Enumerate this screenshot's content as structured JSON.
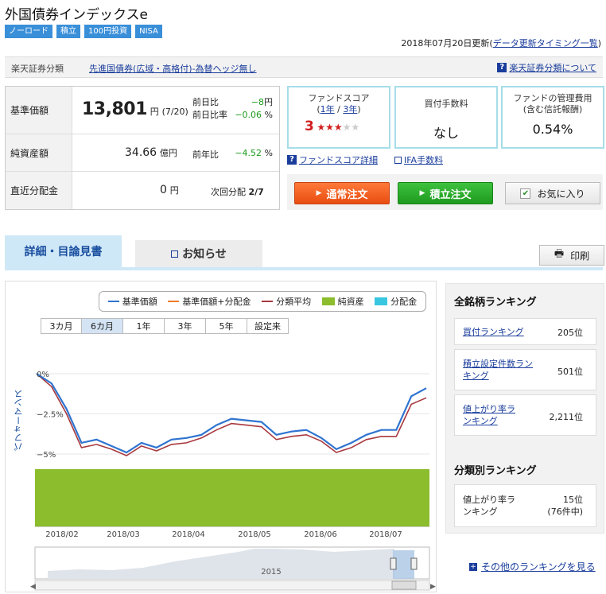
{
  "fund": {
    "title": "外国債券インデックスe",
    "tags": [
      "ノーロード",
      "積立",
      "100円投資",
      "NISA"
    ]
  },
  "update": {
    "date_text": "2018年07月20日更新(",
    "link_text": "データ更新タイミング一覧",
    "close_paren": ")"
  },
  "classification": {
    "label": "楽天証券分類",
    "value": "先進国債券(広域・高格付)-為替ヘッジ無し",
    "help_link": "楽天証券分類について"
  },
  "price": {
    "nav_label": "基準価額",
    "nav_value": "13,801",
    "nav_unit": "円",
    "nav_date": "(7/20)",
    "prev_diff_label": "前日比",
    "prev_diff_value": "−8",
    "prev_diff_unit": "円",
    "prev_ratio_label": "前日比率",
    "prev_ratio_value": "−0.06",
    "prev_ratio_unit": "%",
    "assets_label": "純資産額",
    "assets_value": "34.66",
    "assets_unit": "億円",
    "yoy_label": "前年比",
    "yoy_value": "−4.52",
    "yoy_unit": "%",
    "dist_label": "直近分配金",
    "dist_value": "0",
    "dist_unit": "円",
    "next_dist_label": "次回分配",
    "next_dist_value": "2/7"
  },
  "cards": {
    "score_title_1": "ファンドスコア",
    "score_title_2_open": "(",
    "score_title_2_link": "1年",
    "score_title_2_sep": " / ",
    "score_title_2_link2": "3年",
    "score_title_2_close": ")",
    "score_value": "3",
    "score_stars": "★★★",
    "score_stars_empty": "★★",
    "fee_title": "買付手数料",
    "fee_value": "なし",
    "mgmt_title_1": "ファンドの管理費用",
    "mgmt_title_2": "(含む信託報酬)",
    "mgmt_value": "0.54%",
    "score_detail_link": "ファンドスコア詳細",
    "ifa_link": "IFA手数料"
  },
  "buttons": {
    "normal_order": "通常注文",
    "tsumitate_order": "積立注文",
    "favorite": "お気に入り",
    "print": "印刷"
  },
  "tabs": {
    "detail": "詳細・目論見書",
    "notice": "お知らせ"
  },
  "chart": {
    "legend": [
      {
        "name": "基準価額",
        "color": "#2f74d0"
      },
      {
        "name": "基準価額+分配金",
        "color": "#ee7d2a"
      },
      {
        "name": "分類平均",
        "color": "#a8393f"
      },
      {
        "name": "純資産",
        "color": "#8bbd2c"
      },
      {
        "name": "分配金",
        "color": "#39c6e0"
      }
    ],
    "ranges": [
      "3カ月",
      "6カ月",
      "1年",
      "3年",
      "5年",
      "設定来"
    ],
    "selected_range": "6カ月",
    "y_axis_label": "パフォーマンス",
    "y_ticks": [
      "0%",
      "−2.5%",
      "−5%"
    ],
    "x_ticks": [
      "2018/02",
      "2018/03",
      "2018/04",
      "2018/05",
      "2018/06",
      "2018/07"
    ],
    "navigator_label": "2015"
  },
  "chart_data": {
    "type": "line",
    "x": [
      "2018/01/22",
      "2018/01/29",
      "2018/02/05",
      "2018/02/12",
      "2018/02/19",
      "2018/02/26",
      "2018/03/05",
      "2018/03/12",
      "2018/03/19",
      "2018/03/26",
      "2018/04/02",
      "2018/04/09",
      "2018/04/16",
      "2018/04/23",
      "2018/04/30",
      "2018/05/07",
      "2018/05/14",
      "2018/05/21",
      "2018/05/28",
      "2018/06/04",
      "2018/06/11",
      "2018/06/18",
      "2018/06/25",
      "2018/07/02",
      "2018/07/09",
      "2018/07/16",
      "2018/07/20"
    ],
    "series": [
      {
        "name": "基準価額",
        "color": "#2f74d0",
        "values": [
          0.0,
          -0.6,
          -2.2,
          -4.3,
          -4.1,
          -4.5,
          -4.9,
          -4.3,
          -4.6,
          -4.1,
          -4.0,
          -3.8,
          -3.2,
          -2.8,
          -2.9,
          -3.0,
          -3.8,
          -3.6,
          -3.5,
          -4.0,
          -4.7,
          -4.3,
          -3.8,
          -3.5,
          -3.5,
          -1.4,
          -0.9
        ]
      },
      {
        "name": "分類平均",
        "color": "#a8393f",
        "values": [
          0.0,
          -0.8,
          -2.5,
          -4.6,
          -4.4,
          -4.7,
          -5.1,
          -4.5,
          -4.8,
          -4.4,
          -4.3,
          -4.0,
          -3.5,
          -3.1,
          -3.2,
          -3.3,
          -4.1,
          -3.9,
          -3.8,
          -4.2,
          -4.9,
          -4.6,
          -4.1,
          -3.9,
          -3.9,
          -1.9,
          -1.5
        ]
      }
    ],
    "ylim": [
      -5.5,
      0.3
    ],
    "net_assets_series": "純資産"
  },
  "rankings": {
    "overall_title": "全銘柄ランキング",
    "items": [
      {
        "label": "買付ランキング",
        "value": "205位"
      },
      {
        "label": "積立設定件数ランキング",
        "value": "501位"
      },
      {
        "label": "値上がり率ランキング",
        "value": "2,211位"
      }
    ],
    "category_title": "分類別ランキング",
    "category_item_label": "値上がり率ランキング",
    "category_item_value": "15位",
    "category_item_sub": "(76件中)",
    "more_link": "その他のランキングを見る"
  }
}
